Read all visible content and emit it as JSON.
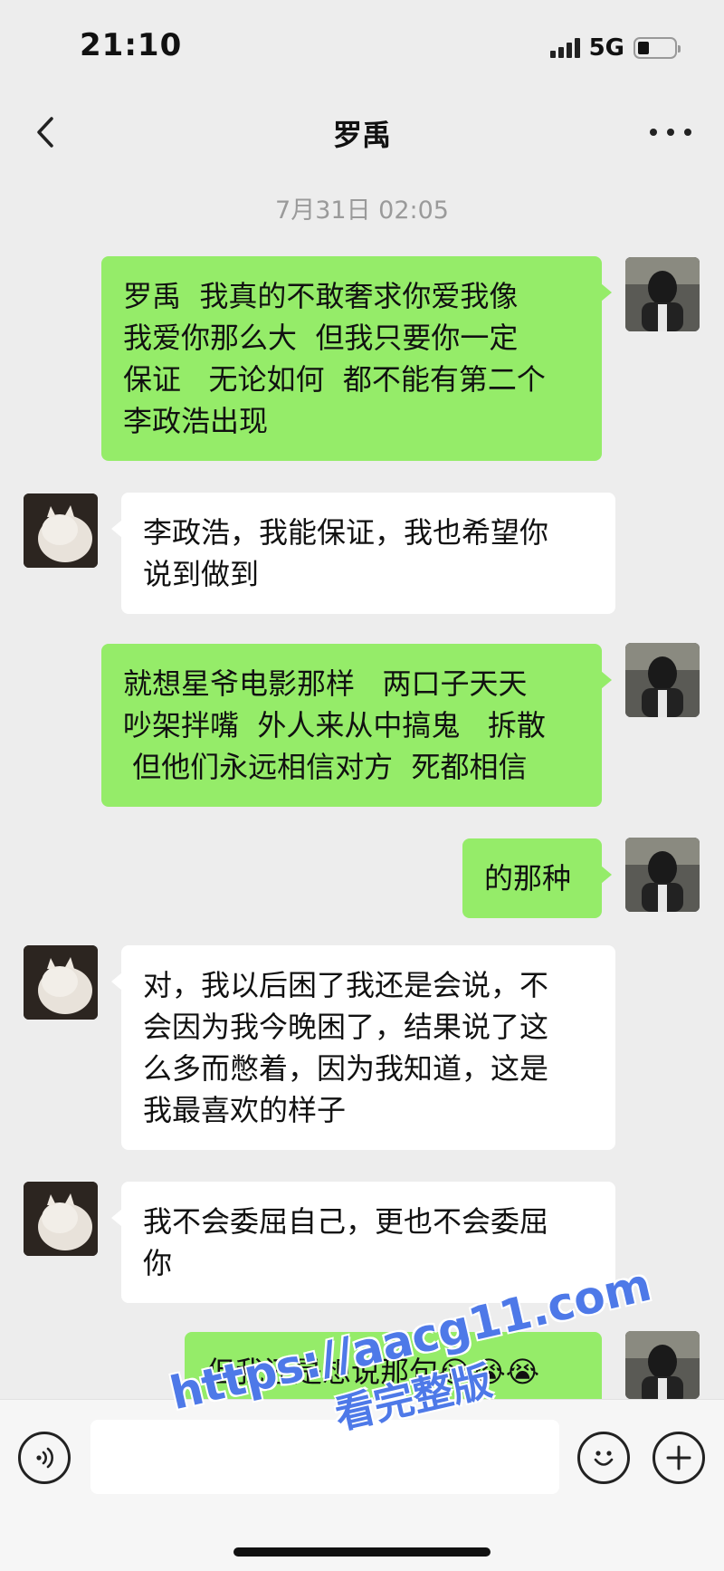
{
  "status_bar": {
    "time": "21:10",
    "network": "5G",
    "icons": [
      "signal-icon",
      "battery-icon"
    ]
  },
  "nav": {
    "title": "罗禹",
    "back_icon": "chevron-left-icon",
    "more_icon": "more-dots-icon"
  },
  "timestamp": "7月31日 02:05",
  "messages": [
    {
      "sender": "me",
      "text": "罗禹  我真的不敢奢求你爱我像\n我爱你那么大  但我只要你一定\n保证   无论如何  都不能有第二个\n李政浩出现"
    },
    {
      "sender": "them",
      "text": "李政浩，我能保证，我也希望你\n说到做到"
    },
    {
      "sender": "me",
      "text": "就想星爷电影那样   两口子天天\n吵架拌嘴  外人来从中搞鬼   拆散\n 但他们永远相信对方  死都相信"
    },
    {
      "sender": "me",
      "text": "的那种"
    },
    {
      "sender": "them",
      "text": "对，我以后困了我还是会说，不\n会因为我今晚困了，结果说了这\n么多而憋着，因为我知道，这是\n我最喜欢的样子"
    },
    {
      "sender": "them",
      "text": "我不会委屈自己，更也不会委屈\n你"
    },
    {
      "sender": "me",
      "text": "但我还是想说那句😭😭😭"
    }
  ],
  "input_bar": {
    "voice_icon": "voice-icon",
    "emoji_icon": "emoji-icon",
    "add_icon": "plus-icon",
    "input_value": ""
  },
  "watermark": {
    "url": "https://aacg11.com",
    "subtitle": "看完整版"
  },
  "colors": {
    "background": "#ededed",
    "my_bubble": "#95ec69",
    "their_bubble": "#ffffff",
    "timestamp": "#9a9a9a",
    "watermark": "#4e79e8"
  }
}
